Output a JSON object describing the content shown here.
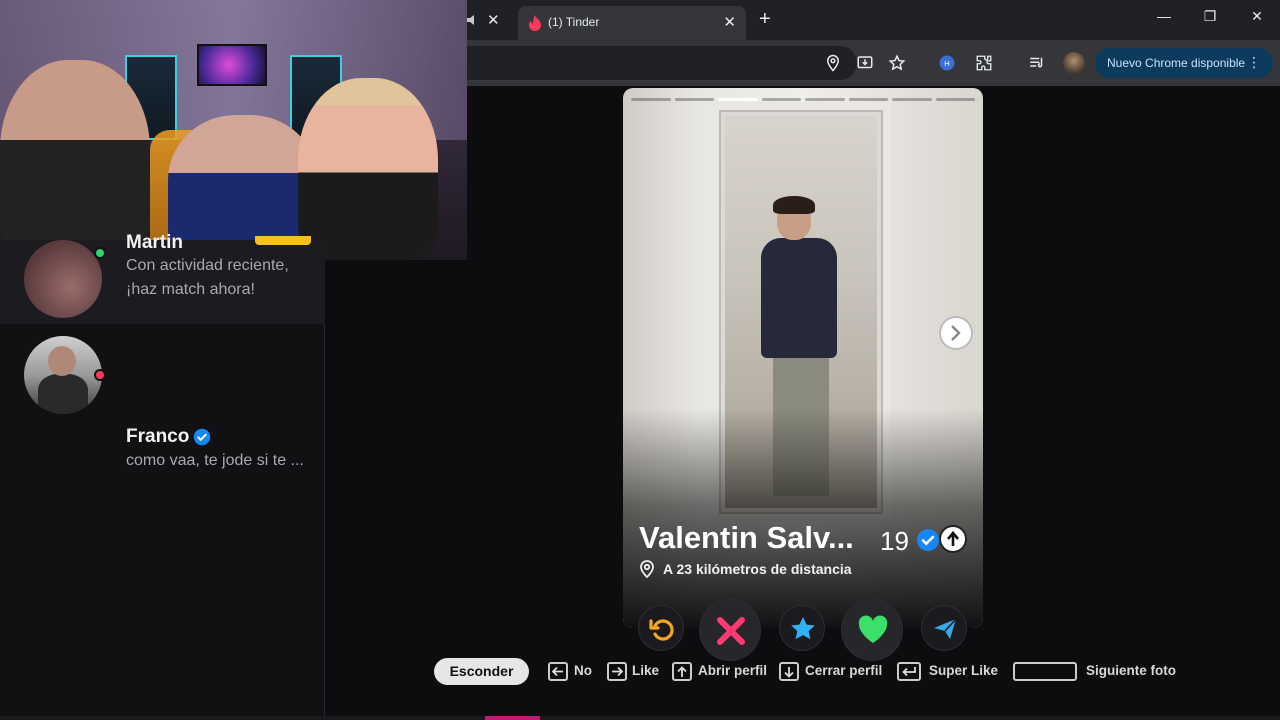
{
  "browser": {
    "tab_title": "(1) Tinder",
    "update_label": "Nuevo Chrome disponible"
  },
  "sidebar": {
    "matches": [
      {
        "name": "Martin",
        "message": "Con actividad reciente, ¡haz match ahora!",
        "status": "online"
      },
      {
        "name": "Franco",
        "message": "como vaa, te jode si te ...",
        "status": "unread",
        "verified": true
      }
    ]
  },
  "profile": {
    "name": "Valentin Salv...",
    "age": "19",
    "distance": "A 23 kilómetros de distancia",
    "verified": true,
    "photo_count": 8,
    "active_photo": 2
  },
  "actions": [
    {
      "name": "rewind",
      "icon": "rewind-icon"
    },
    {
      "name": "nope",
      "icon": "x-icon"
    },
    {
      "name": "super-like",
      "icon": "star-icon"
    },
    {
      "name": "like",
      "icon": "heart-icon"
    },
    {
      "name": "boost",
      "icon": "send-icon"
    }
  ],
  "shortcuts": {
    "hide": "Esconder",
    "no": "No",
    "like": "Like",
    "open_profile": "Abrir perfil",
    "close_profile": "Cerrar perfil",
    "super_like": "Super Like",
    "next_photo": "Siguiente foto"
  },
  "colors": {
    "tinder_pink": "#fd3a5a",
    "update_btn_bg": "#0b3a5c",
    "verified_blue": "#1786f8"
  }
}
